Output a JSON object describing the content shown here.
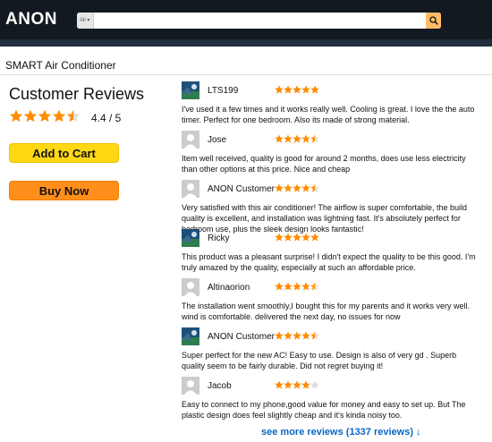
{
  "header": {
    "logo": "ANON",
    "search_category": "All",
    "search_value": "",
    "search_placeholder": ""
  },
  "product": {
    "title": "SMART Air Conditioner"
  },
  "summary": {
    "heading": "Customer Reviews",
    "rating_text": "4.4 / 5",
    "rating_value": 4.4,
    "add_to_cart_label": "Add to Cart",
    "buy_now_label": "Buy Now"
  },
  "colors": {
    "star": "#ff8c00",
    "star_empty": "#dddddd",
    "add_to_cart": "#ffd814",
    "buy_now": "#ff8f1a",
    "link": "#0a66c2"
  },
  "reviews": [
    {
      "name": "LTS199",
      "rating": 5,
      "avatar": "photo",
      "text": "I've used it a few times and it works really well. Cooling is great. I love the the auto timer. Perfect for one bedroom. Also its made of strong material."
    },
    {
      "name": "Jose",
      "rating": 4.5,
      "avatar": "default",
      "text": "Item well received, quality is good for around 2 months, does use less electricity than other options at this price. Nice and cheap"
    },
    {
      "name": "ANON Customer",
      "rating": 4.5,
      "avatar": "default",
      "text": "Very satisfied with this air conditioner! The airflow is super comfortable, the build quality is excellent, and installation was lightning fast. It's absolutely perfect for bedroom use, plus the sleek design looks fantastic!"
    },
    {
      "name": "Ricky",
      "rating": 5,
      "avatar": "photo",
      "text": "This product was a pleasant surprise! I didn't expect the  quality to be this good. I'm truly amazed by the quality, especially at such an affordable price."
    },
    {
      "name": "Altinaorion",
      "rating": 4.5,
      "avatar": "default",
      "text": "The installation went smoothly,I bought this for my parents and it works very well. wind is comfortable. delivered the next day, no issues for now"
    },
    {
      "name": "ANON Customer",
      "rating": 4.5,
      "avatar": "photo",
      "text": "Super perfect for the new AC! Easy to use. Design is also of very gd . Superb quality seem to be fairly durable. Did not regret buying it!"
    },
    {
      "name": "Jacob",
      "rating": 4,
      "avatar": "default",
      "text": "Easy to connect to my phone,good value for money and easy to set up. But The plastic design does feel slightly cheap and it's kinda noisy too."
    }
  ],
  "more_reviews_label": "see more reviews (1337 reviews) ↓"
}
